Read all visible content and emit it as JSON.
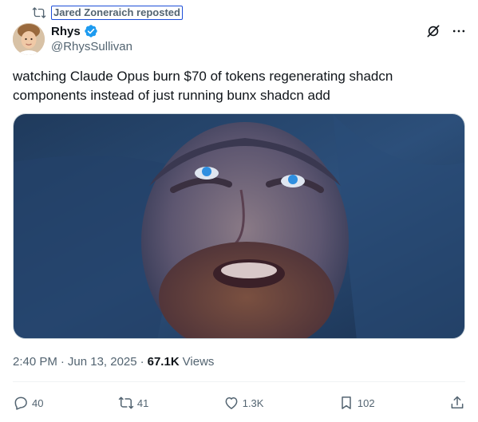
{
  "repost": {
    "text": "Jared Zoneraich reposted",
    "icon": "repost-icon"
  },
  "author": {
    "name": "Rhys",
    "handle": "@RhysSullivan",
    "verified": true,
    "avatar_icon": "avatar"
  },
  "tweet": {
    "text": "watching Claude Opus burn $70 of tokens regenerating shadcn components instead of just running bunx shadcn add"
  },
  "media": {
    "icon": "video-still-image"
  },
  "meta": {
    "time": "2:40 PM",
    "sep1": "·",
    "date": "Jun 13, 2025",
    "sep2": "·",
    "views": "67.1K",
    "views_label": "Views"
  },
  "actions": {
    "replies": "40",
    "reposts": "41",
    "likes": "1.3K",
    "bookmarks": "102"
  },
  "colors": {
    "accent": "#1d9bf0",
    "muted": "#536471",
    "text": "#0f1419"
  }
}
